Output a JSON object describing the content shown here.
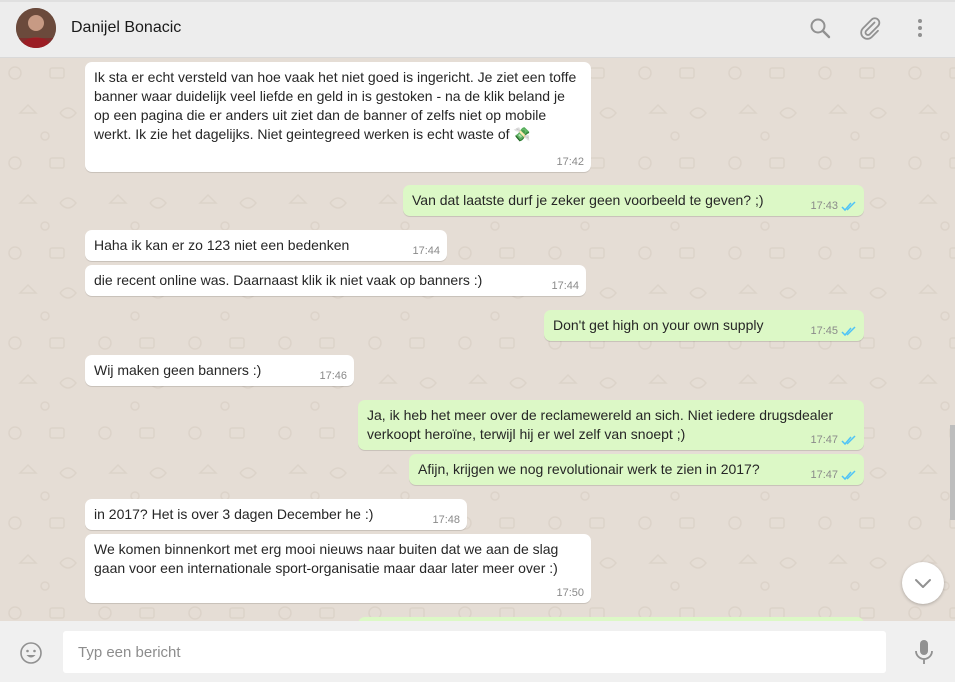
{
  "header": {
    "contact_name": "Danijel Bonacic",
    "icons": [
      "search-icon",
      "attach-icon",
      "menu-icon"
    ]
  },
  "messages": [
    {
      "direction": "in",
      "text": "Ik sta er echt versteld van hoe vaak het niet goed is ingericht. Je ziet een toffe banner waar duidelijk veel liefde en geld in is gestoken - na de klik beland je op een pagina die er anders uit ziet dan de banner of zelfs niet op mobile werkt. Ik zie het dagelijks. Niet geintegreed werken is echt waste of 💸",
      "time": "17:42"
    },
    {
      "direction": "out",
      "text": "Van dat laatste durf je zeker geen voorbeeld te geven? ;)",
      "time": "17:43",
      "read": true
    },
    {
      "direction": "in",
      "text": "Haha ik kan er zo 123 niet een bedenken",
      "time": "17:44"
    },
    {
      "direction": "in",
      "text": "die recent online was. Daarnaast klik ik niet vaak op banners :)",
      "time": "17:44"
    },
    {
      "direction": "out",
      "text": "Don't get high on your own supply",
      "time": "17:45",
      "read": true
    },
    {
      "direction": "in",
      "text": "Wij maken geen banners :)",
      "time": "17:46"
    },
    {
      "direction": "out",
      "text": "Ja, ik heb het meer over de reclamewereld an sich. Niet iedere drugsdealer verkoopt heroïne, terwijl hij er wel zelf van snoept ;)",
      "time": "17:47",
      "read": true
    },
    {
      "direction": "out",
      "text": "Afijn, krijgen we nog revolutionair werk te zien in 2017?",
      "time": "17:47",
      "read": true
    },
    {
      "direction": "in",
      "text": "in 2017? Het is over 3 dagen December he :)",
      "time": "17:48"
    },
    {
      "direction": "in",
      "text": "We komen binnenkort met erg mooi nieuws naar buiten dat we aan de slag gaan voor een internationale sport-organisatie maar daar later meer over :)",
      "time": "17:50"
    }
  ],
  "composer": {
    "placeholder": "Typ een bericht",
    "value": ""
  },
  "colors": {
    "incoming_bubble": "#ffffff",
    "outgoing_bubble": "#dcf8c6",
    "read_ticks": "#4fc3f7",
    "chat_background": "#e5ddd5"
  }
}
